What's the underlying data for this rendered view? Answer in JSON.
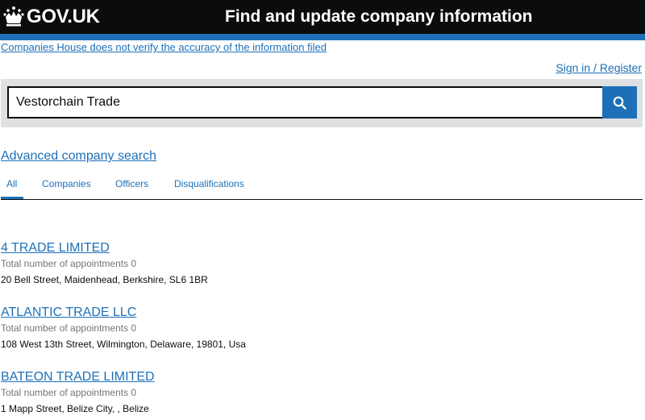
{
  "header": {
    "logo_text": "GOV.UK",
    "service_name": "Find and update company information"
  },
  "disclaimer": "Companies House does not verify the accuracy of the information filed",
  "sign_in": "Sign in / Register",
  "search": {
    "value": "Vestorchain Trade",
    "button_icon": "search-icon"
  },
  "advanced_search": "Advanced company search",
  "tabs": [
    {
      "label": "All",
      "active": true
    },
    {
      "label": "Companies",
      "active": false
    },
    {
      "label": "Officers",
      "active": false
    },
    {
      "label": "Disqualifications",
      "active": false
    }
  ],
  "results": [
    {
      "title": "4 TRADE LIMITED",
      "meta": "Total number of appointments 0",
      "address": "20 Bell Street, Maidenhead, Berkshire, SL6 1BR"
    },
    {
      "title": "ATLANTIC TRADE LLC",
      "meta": "Total number of appointments 0",
      "address": "108 West 13th Street, Wilmington, Delaware, 19801, Usa"
    },
    {
      "title": "BATEON TRADE LIMITED",
      "meta": "Total number of appointments 0",
      "address": "1 Mapp Street, Belize City, , Belize"
    }
  ],
  "colors": {
    "header_bg": "#0b0c0c",
    "brand_blue": "#1d70b8",
    "panel_grey": "#dee0e2",
    "secondary_text": "#6f777b"
  }
}
